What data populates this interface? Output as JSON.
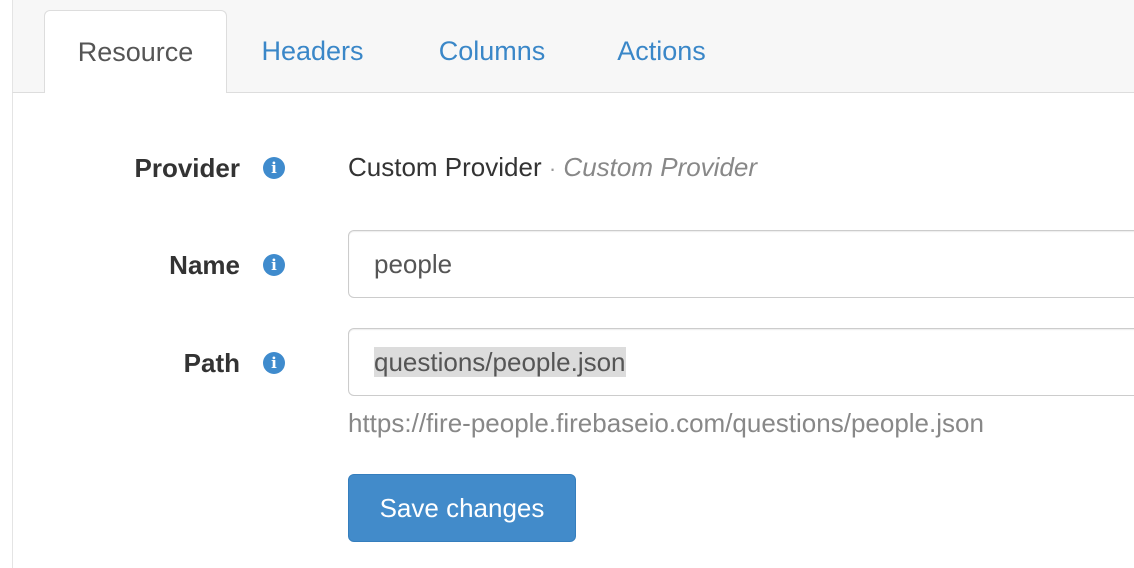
{
  "tabs": [
    {
      "label": "Resource",
      "active": true
    },
    {
      "label": "Headers",
      "active": false
    },
    {
      "label": "Columns",
      "active": false
    },
    {
      "label": "Actions",
      "active": false
    }
  ],
  "form": {
    "provider": {
      "label": "Provider",
      "value": "Custom Provider",
      "separator": "·",
      "subtitle": "Custom Provider"
    },
    "name": {
      "label": "Name",
      "value": "people"
    },
    "path": {
      "label": "Path",
      "value": "questions/people.json",
      "help": "https://fire-people.firebaseio.com/questions/people.json"
    },
    "info_icon_glyph": "i",
    "save_label": "Save changes"
  },
  "colors": {
    "link": "#3a87c8",
    "primary_button": "#428bca",
    "info_icon": "#3f8bcd"
  },
  "icons": {
    "info": "info-circle-icon"
  }
}
